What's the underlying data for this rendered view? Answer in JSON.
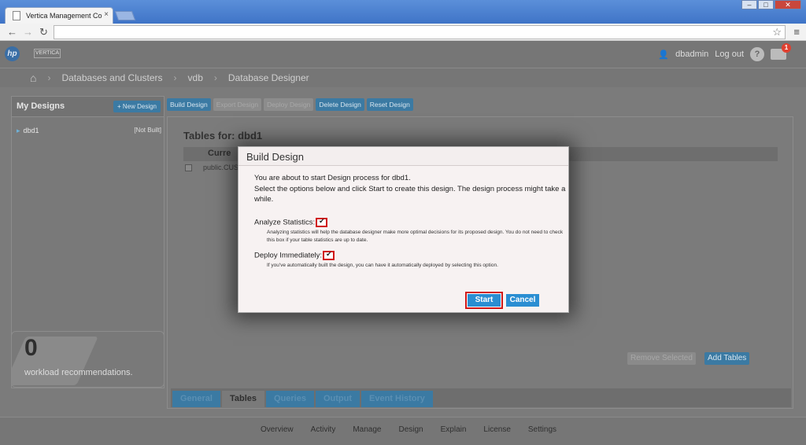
{
  "browser": {
    "tab_title": "Vertica Management Co",
    "tab_close": "×",
    "window_buttons": [
      "‒",
      "□",
      "✕"
    ]
  },
  "header": {
    "user": "dbadmin",
    "logout": "Log out",
    "help": "?",
    "notification_count": "1"
  },
  "breadcrumb": [
    "Databases and Clusters",
    "vdb",
    "Database Designer"
  ],
  "left_panel": {
    "title": "My Designs",
    "new_design": "+ New Design",
    "designs": [
      {
        "name": "dbd1",
        "status": "[Not Built]"
      }
    ]
  },
  "workload": {
    "count": "0",
    "label": "workload recommendations."
  },
  "actions": [
    "Build Design",
    "Export Design",
    "Deploy Design",
    "Delete Design",
    "Reset Design"
  ],
  "main": {
    "title": "Tables for: dbd1",
    "column_header": "Curre",
    "row_text": "public.CUS",
    "remove_selected": "Remove Selected",
    "add_tables": "Add Tables",
    "tabs": [
      "General",
      "Tables",
      "Queries",
      "Output",
      "Event History"
    ],
    "active_tab": "Tables"
  },
  "footer": [
    "Overview",
    "Activity",
    "Manage",
    "Design",
    "Explain",
    "License",
    "Settings"
  ],
  "modal": {
    "title": "Build Design",
    "intro_line1": "You are about to start Design process for dbd1.",
    "intro_line2": "Select the options below and click Start to create this design. The design process might take a while.",
    "analyze_label": "Analyze Statistics:",
    "analyze_checked": true,
    "analyze_help": "Analyzing statistics will help the database designer make more optimal decisions for its proposed design. You do not need to check this box if your table statistics are up to date.",
    "deploy_label": "Deploy Immediately:",
    "deploy_checked": true,
    "deploy_help": "If you've automatically built the design, you can have it automatically deployed by selecting this option.",
    "start": "Start",
    "cancel": "Cancel"
  },
  "colors": {
    "accent": "#2a8ed2",
    "highlight": "#d01818"
  }
}
